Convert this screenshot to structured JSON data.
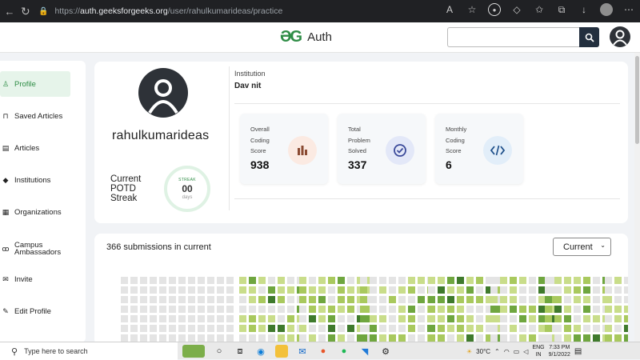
{
  "browser": {
    "url_prefix": "https://",
    "url_host": "auth.geeksforgeeks.org",
    "url_path": "/user/rahulkumarideas/practice"
  },
  "header": {
    "logo_mark": "ƏG",
    "logo_text": "Auth"
  },
  "sidebar": {
    "items": [
      {
        "label": "Profile",
        "icon": "user-icon",
        "active": true
      },
      {
        "label": "Saved Articles",
        "icon": "bookmark-icon"
      },
      {
        "label": "Articles",
        "icon": "article-icon"
      },
      {
        "label": "Institutions",
        "icon": "graduation-cap-icon"
      },
      {
        "label": "Organizations",
        "icon": "building-icon"
      },
      {
        "label": "Campus Ambassadors",
        "icon": "group-icon"
      },
      {
        "label": "Invite",
        "icon": "mail-icon"
      },
      {
        "label": "Edit Profile",
        "icon": "pencil-icon"
      }
    ]
  },
  "profile": {
    "username": "rahulkumarideas",
    "potd_label_1": "Current",
    "potd_label_2": "POTD",
    "potd_label_3": "Streak",
    "streak_badge": "STREAK",
    "streak_value": "00",
    "streak_unit": "days",
    "institution_label": "Institution",
    "institution_value": "Dav nit"
  },
  "stats": [
    {
      "label_1": "Overall",
      "label_2": "Coding",
      "label_3": "Score",
      "value": "938",
      "icon": "bar-chart-icon",
      "icon_bg": "#fbeae2",
      "icon_color": "#8a4a32"
    },
    {
      "label_1": "Total",
      "label_2": "Problem",
      "label_3": "Solved",
      "value": "337",
      "icon": "check-circle-icon",
      "icon_bg": "#e3e8f8",
      "icon_color": "#3b4a9a"
    },
    {
      "label_1": "Monthly",
      "label_2": "Coding",
      "label_3": "Score",
      "value": "6",
      "icon": "code-icon",
      "icon_bg": "#e2eef9",
      "icon_color": "#1d4f8a"
    }
  ],
  "submissions": {
    "title": "366 submissions in current",
    "period_selected": "Current"
  },
  "colors": {
    "brand_green": "#2f8d46",
    "empty_cell": "#e4e4e4",
    "level1": "#c9dd8a",
    "level2": "#a9c95e",
    "level3": "#6fa63f",
    "level4": "#3f7a2c"
  },
  "taskbar": {
    "search_placeholder": "Type here to search",
    "weather": "30°C",
    "lang_1": "ENG",
    "lang_2": "IN",
    "time": "7:33 PM",
    "date": "9/1/2022"
  }
}
